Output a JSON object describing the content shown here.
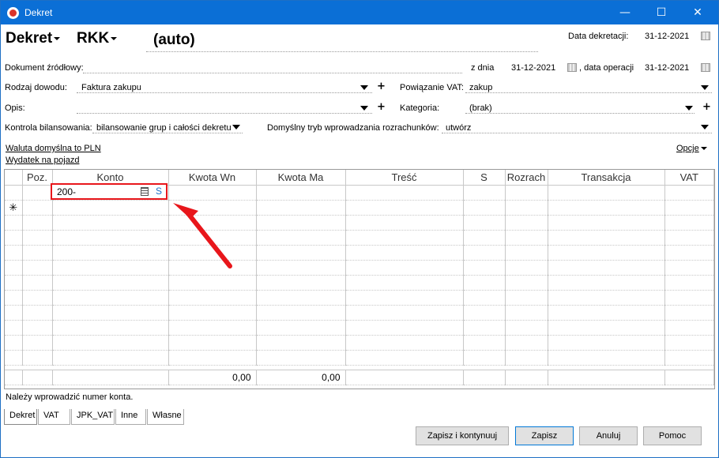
{
  "window": {
    "title": "Dekret",
    "minimize": "—",
    "maximize": "☐",
    "close": "✕"
  },
  "header": {
    "doc_type": "Dekret",
    "register": "RKK",
    "number": "(auto)",
    "date_label": "Data dekretacji:",
    "date_value": "31-12-2021"
  },
  "source_doc": {
    "label": "Dokument źródłowy:",
    "from_label": "z dnia",
    "from_value": "31-12-2021",
    "op_label": ", data operacji",
    "op_value": "31-12-2021"
  },
  "proof_type": {
    "label": "Rodzaj dowodu:",
    "value": "Faktura zakupu"
  },
  "vat_link": {
    "label": "Powiązanie VAT:",
    "value": "zakup"
  },
  "description": {
    "label": "Opis:",
    "value": ""
  },
  "category": {
    "label": "Kategoria:",
    "value": "(brak)"
  },
  "balance_control": {
    "label": "Kontrola bilansowania:",
    "value": "bilansowanie grup i całości dekretu"
  },
  "settlement_mode": {
    "label": "Domyślny tryb wprowadzania rozrachunków:",
    "value": "utwórz"
  },
  "links": {
    "currency": "Waluta domyślna to PLN",
    "vehicle": "Wydatek na pojazd",
    "options": "Opcje"
  },
  "grid": {
    "columns": [
      "",
      "Poz.",
      "Konto",
      "Kwota Wn",
      "Kwota Ma",
      "Treść",
      "S",
      "Rozrach",
      "Transakcja",
      "VAT"
    ],
    "new_row_marker": "✳",
    "edit_value": "200-",
    "edit_s": "S",
    "sum_wn": "0,00",
    "sum_ma": "0,00"
  },
  "status_message": "Należy wprowadzić numer konta.",
  "tabs": [
    "Dekret",
    "VAT",
    "JPK_VAT",
    "Inne",
    "Własne"
  ],
  "buttons": {
    "save_continue": "Zapisz i kontynuuj",
    "save": "Zapisz",
    "cancel": "Anuluj",
    "help": "Pomoc"
  },
  "colors": {
    "titlebar": "#0b6fd6",
    "highlight": "#e8161b",
    "arrow": "#e8161b"
  }
}
